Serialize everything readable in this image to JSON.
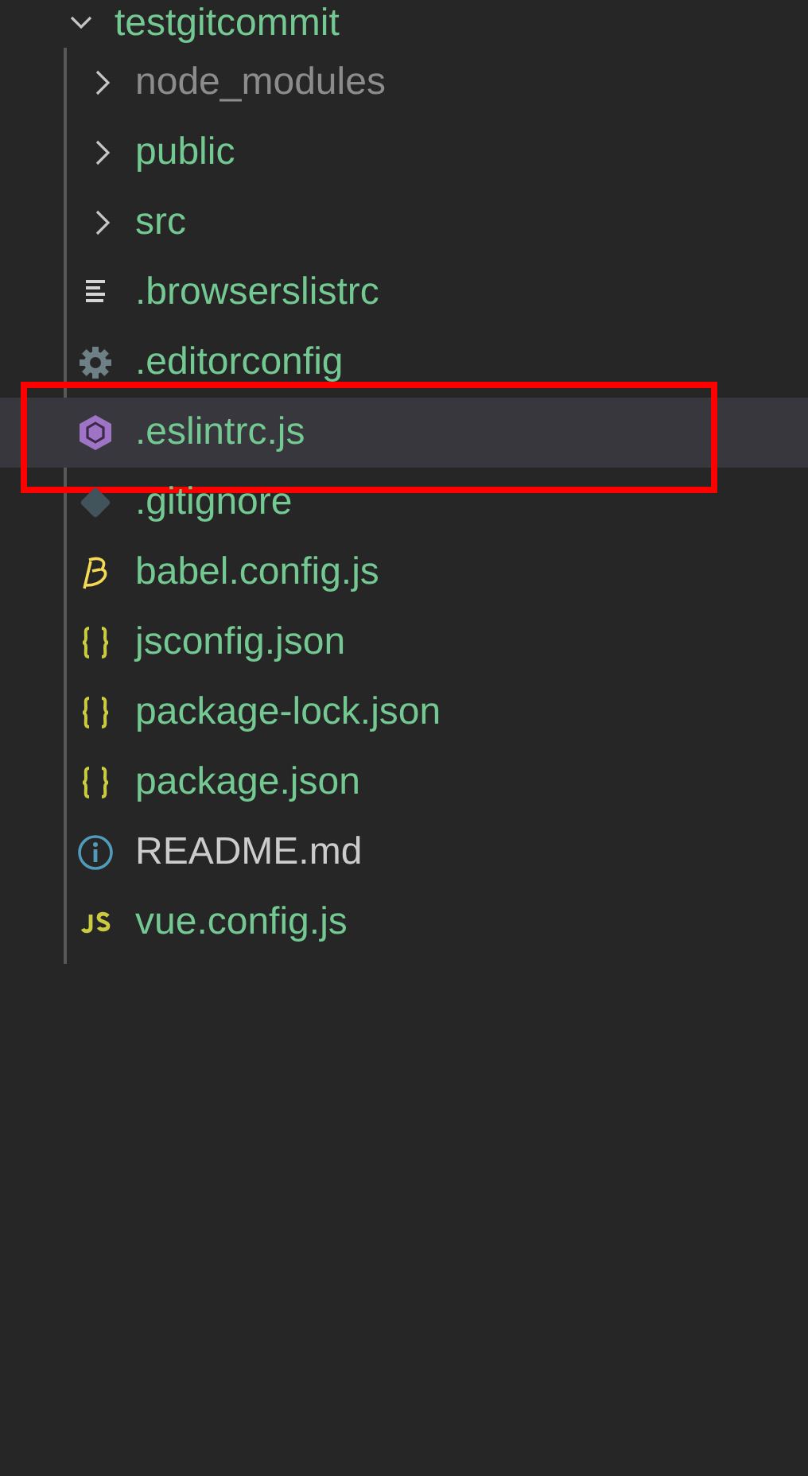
{
  "root": {
    "name": "testgitcommit",
    "expanded": true,
    "color": "#73c991"
  },
  "items": [
    {
      "name": "node_modules",
      "kind": "folder",
      "expanded": false,
      "color": "#8c8c8c",
      "selected": false,
      "highlighted": false
    },
    {
      "name": "public",
      "kind": "folder",
      "expanded": false,
      "color": "#73c991",
      "selected": false,
      "highlighted": false
    },
    {
      "name": "src",
      "kind": "folder",
      "expanded": false,
      "color": "#73c991",
      "selected": false,
      "highlighted": false
    },
    {
      "name": ".browserslistrc",
      "kind": "lines",
      "color": "#73c991",
      "selected": false,
      "highlighted": false
    },
    {
      "name": ".editorconfig",
      "kind": "gear",
      "color": "#73c991",
      "selected": false,
      "highlighted": false
    },
    {
      "name": ".eslintrc.js",
      "kind": "eslint",
      "color": "#73c991",
      "selected": true,
      "highlighted": true
    },
    {
      "name": ".gitignore",
      "kind": "git",
      "color": "#73c991",
      "selected": false,
      "highlighted": false
    },
    {
      "name": "babel.config.js",
      "kind": "babel",
      "color": "#73c991",
      "selected": false,
      "highlighted": false
    },
    {
      "name": "jsconfig.json",
      "kind": "json",
      "color": "#73c991",
      "selected": false,
      "highlighted": false
    },
    {
      "name": "package-lock.json",
      "kind": "json",
      "color": "#73c991",
      "selected": false,
      "highlighted": false
    },
    {
      "name": "package.json",
      "kind": "json",
      "color": "#73c991",
      "selected": false,
      "highlighted": false
    },
    {
      "name": "README.md",
      "kind": "info",
      "color": "#cccccc",
      "selected": false,
      "highlighted": false
    },
    {
      "name": "vue.config.js",
      "kind": "js",
      "color": "#73c991",
      "selected": false,
      "highlighted": false
    }
  ]
}
